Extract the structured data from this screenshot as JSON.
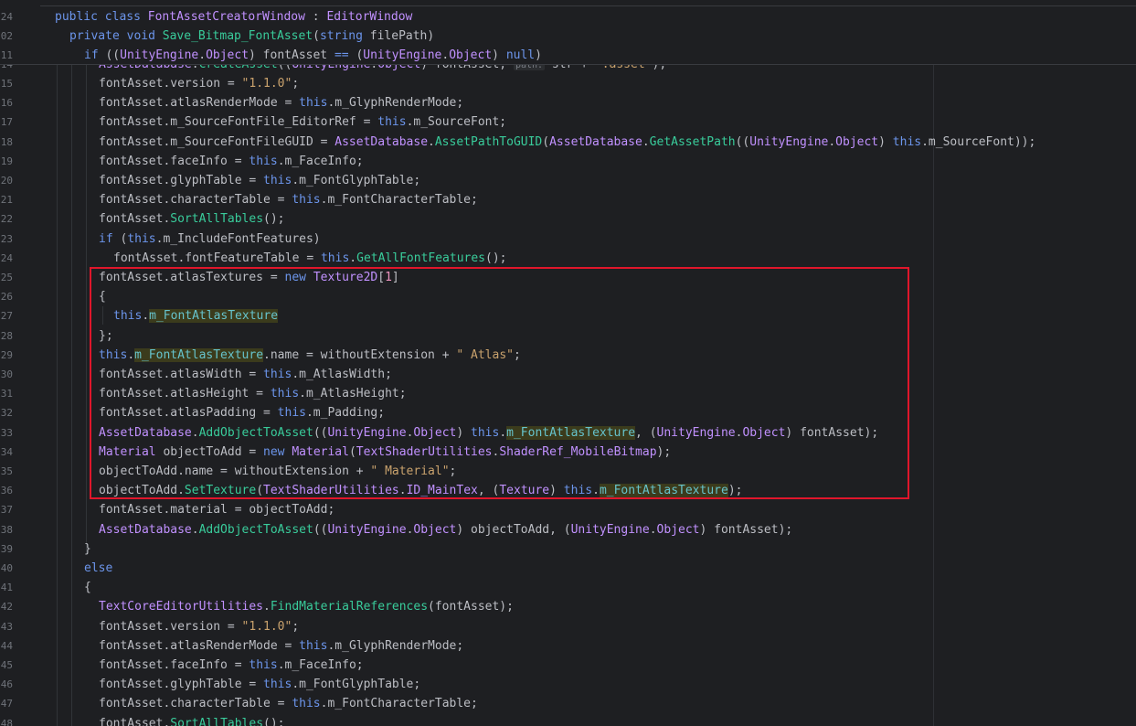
{
  "sticky_lines": [
    {
      "num": "24",
      "indent": 60,
      "tokens": [
        [
          "kw",
          "public "
        ],
        [
          "kw",
          "class "
        ],
        [
          "type",
          "FontAssetCreatorWindow"
        ],
        [
          "plain",
          " : "
        ],
        [
          "type",
          "EditorWindow"
        ]
      ]
    },
    {
      "num": "02",
      "indent": 76,
      "tokens": [
        [
          "kw",
          "private "
        ],
        [
          "kw",
          "void "
        ],
        [
          "method",
          "Save_Bitmap_FontAsset"
        ],
        [
          "plain",
          "("
        ],
        [
          "kw",
          "string "
        ],
        [
          "plain",
          "filePath)"
        ]
      ]
    },
    {
      "num": "11",
      "indent": 92,
      "tokens": [
        [
          "kw",
          "if "
        ],
        [
          "plain",
          "(("
        ],
        [
          "type",
          "UnityEngine"
        ],
        [
          "plain",
          "."
        ],
        [
          "type",
          "Object"
        ],
        [
          "plain",
          ") fontAsset "
        ],
        [
          "kw",
          "== "
        ],
        [
          "plain",
          "("
        ],
        [
          "type",
          "UnityEngine"
        ],
        [
          "plain",
          "."
        ],
        [
          "type",
          "Object"
        ],
        [
          "plain",
          ") "
        ],
        [
          "kw",
          "null"
        ],
        [
          "plain",
          ")"
        ]
      ]
    }
  ],
  "partial_line": {
    "num": "14",
    "tokens": [
      [
        "type",
        "AssetDatabase"
      ],
      [
        "plain",
        "."
      ],
      [
        "method",
        "CreateAsset"
      ],
      [
        "plain",
        "(("
      ],
      [
        "type",
        "UnityEngine"
      ],
      [
        "plain",
        "."
      ],
      [
        "type",
        "Object"
      ],
      [
        "plain",
        ") fontAsset, "
      ],
      [
        "hint",
        "path:"
      ],
      [
        "plain",
        " str + "
      ],
      [
        "str",
        "\".asset\""
      ],
      [
        "plain",
        ");"
      ]
    ]
  },
  "lines": [
    {
      "num": "15",
      "indent": 108,
      "tokens": [
        [
          "plain",
          "fontAsset.version = "
        ],
        [
          "str",
          "\"1.1.0\""
        ],
        [
          "plain",
          ";"
        ]
      ]
    },
    {
      "num": "16",
      "indent": 108,
      "tokens": [
        [
          "plain",
          "fontAsset.atlasRenderMode = "
        ],
        [
          "kw",
          "this"
        ],
        [
          "plain",
          ".m_GlyphRenderMode;"
        ]
      ]
    },
    {
      "num": "17",
      "indent": 108,
      "tokens": [
        [
          "plain",
          "fontAsset.m_SourceFontFile_EditorRef = "
        ],
        [
          "kw",
          "this"
        ],
        [
          "plain",
          ".m_SourceFont;"
        ]
      ]
    },
    {
      "num": "18",
      "indent": 108,
      "tokens": [
        [
          "plain",
          "fontAsset.m_SourceFontFileGUID = "
        ],
        [
          "type",
          "AssetDatabase"
        ],
        [
          "plain",
          "."
        ],
        [
          "method",
          "AssetPathToGUID"
        ],
        [
          "plain",
          "("
        ],
        [
          "type",
          "AssetDatabase"
        ],
        [
          "plain",
          "."
        ],
        [
          "method",
          "GetAssetPath"
        ],
        [
          "plain",
          "(("
        ],
        [
          "type",
          "UnityEngine"
        ],
        [
          "plain",
          "."
        ],
        [
          "type",
          "Object"
        ],
        [
          "plain",
          ") "
        ],
        [
          "kw",
          "this"
        ],
        [
          "plain",
          ".m_SourceFont));"
        ]
      ]
    },
    {
      "num": "19",
      "indent": 108,
      "tokens": [
        [
          "plain",
          "fontAsset.faceInfo = "
        ],
        [
          "kw",
          "this"
        ],
        [
          "plain",
          ".m_FaceInfo;"
        ]
      ]
    },
    {
      "num": "20",
      "indent": 108,
      "tokens": [
        [
          "plain",
          "fontAsset.glyphTable = "
        ],
        [
          "kw",
          "this"
        ],
        [
          "plain",
          ".m_FontGlyphTable;"
        ]
      ]
    },
    {
      "num": "21",
      "indent": 108,
      "tokens": [
        [
          "plain",
          "fontAsset.characterTable = "
        ],
        [
          "kw",
          "this"
        ],
        [
          "plain",
          ".m_FontCharacterTable;"
        ]
      ]
    },
    {
      "num": "22",
      "indent": 108,
      "tokens": [
        [
          "plain",
          "fontAsset."
        ],
        [
          "method",
          "SortAllTables"
        ],
        [
          "plain",
          "();"
        ]
      ]
    },
    {
      "num": "23",
      "indent": 108,
      "tokens": [
        [
          "kw",
          "if "
        ],
        [
          "plain",
          "("
        ],
        [
          "kw",
          "this"
        ],
        [
          "plain",
          ".m_IncludeFontFeatures)"
        ]
      ]
    },
    {
      "num": "24",
      "indent": 124,
      "tokens": [
        [
          "plain",
          "fontAsset.fontFeatureTable = "
        ],
        [
          "kw",
          "this"
        ],
        [
          "plain",
          "."
        ],
        [
          "method",
          "GetAllFontFeatures"
        ],
        [
          "plain",
          "();"
        ]
      ]
    },
    {
      "num": "25",
      "indent": 108,
      "tokens": [
        [
          "plain",
          "fontAsset.atlasTextures = "
        ],
        [
          "kw",
          "new "
        ],
        [
          "type",
          "Texture2D"
        ],
        [
          "plain",
          "["
        ],
        [
          "num",
          "1"
        ],
        [
          "plain",
          "]"
        ]
      ]
    },
    {
      "num": "26",
      "indent": 108,
      "tokens": [
        [
          "plain",
          "{"
        ]
      ]
    },
    {
      "num": "27",
      "indent": 124,
      "tokens": [
        [
          "kw",
          "this"
        ],
        [
          "plain",
          "."
        ],
        [
          "hl",
          "m_FontAtlasTexture"
        ]
      ]
    },
    {
      "num": "28",
      "indent": 108,
      "tokens": [
        [
          "plain",
          "};"
        ]
      ]
    },
    {
      "num": "29",
      "indent": 108,
      "tokens": [
        [
          "kw",
          "this"
        ],
        [
          "plain",
          "."
        ],
        [
          "hl",
          "m_FontAtlasTexture"
        ],
        [
          "plain",
          ".name = withoutExtension + "
        ],
        [
          "str",
          "\" Atlas\""
        ],
        [
          "plain",
          ";"
        ]
      ]
    },
    {
      "num": "30",
      "indent": 108,
      "tokens": [
        [
          "plain",
          "fontAsset.atlasWidth = "
        ],
        [
          "kw",
          "this"
        ],
        [
          "plain",
          ".m_AtlasWidth;"
        ]
      ]
    },
    {
      "num": "31",
      "indent": 108,
      "tokens": [
        [
          "plain",
          "fontAsset.atlasHeight = "
        ],
        [
          "kw",
          "this"
        ],
        [
          "plain",
          ".m_AtlasHeight;"
        ]
      ]
    },
    {
      "num": "32",
      "indent": 108,
      "tokens": [
        [
          "plain",
          "fontAsset.atlasPadding = "
        ],
        [
          "kw",
          "this"
        ],
        [
          "plain",
          ".m_Padding;"
        ]
      ]
    },
    {
      "num": "33",
      "indent": 108,
      "tokens": [
        [
          "type",
          "AssetDatabase"
        ],
        [
          "plain",
          "."
        ],
        [
          "method",
          "AddObjectToAsset"
        ],
        [
          "plain",
          "(("
        ],
        [
          "type",
          "UnityEngine"
        ],
        [
          "plain",
          "."
        ],
        [
          "type",
          "Object"
        ],
        [
          "plain",
          ") "
        ],
        [
          "kw",
          "this"
        ],
        [
          "plain",
          "."
        ],
        [
          "hl",
          "m_FontAtlasTexture"
        ],
        [
          "plain",
          ", ("
        ],
        [
          "type",
          "UnityEngine"
        ],
        [
          "plain",
          "."
        ],
        [
          "type",
          "Object"
        ],
        [
          "plain",
          ") fontAsset);"
        ]
      ]
    },
    {
      "num": "34",
      "indent": 108,
      "tokens": [
        [
          "type",
          "Material "
        ],
        [
          "plain",
          "objectToAdd = "
        ],
        [
          "kw",
          "new "
        ],
        [
          "type",
          "Material"
        ],
        [
          "plain",
          "("
        ],
        [
          "type",
          "TextShaderUtilities"
        ],
        [
          "plain",
          "."
        ],
        [
          "type",
          "ShaderRef_MobileBitmap"
        ],
        [
          "plain",
          ");"
        ]
      ]
    },
    {
      "num": "35",
      "indent": 108,
      "tokens": [
        [
          "plain",
          "objectToAdd.name = withoutExtension + "
        ],
        [
          "str",
          "\" Material\""
        ],
        [
          "plain",
          ";"
        ]
      ]
    },
    {
      "num": "36",
      "indent": 108,
      "tokens": [
        [
          "plain",
          "objectToAdd."
        ],
        [
          "method",
          "SetTexture"
        ],
        [
          "plain",
          "("
        ],
        [
          "type",
          "TextShaderUtilities"
        ],
        [
          "plain",
          "."
        ],
        [
          "type",
          "ID_MainTex"
        ],
        [
          "plain",
          ", ("
        ],
        [
          "type",
          "Texture"
        ],
        [
          "plain",
          ") "
        ],
        [
          "kw",
          "this"
        ],
        [
          "plain",
          "."
        ],
        [
          "hl",
          "m_FontAtlasTexture"
        ],
        [
          "plain",
          ");"
        ]
      ]
    },
    {
      "num": "37",
      "indent": 108,
      "tokens": [
        [
          "plain",
          "fontAsset.material = objectToAdd;"
        ]
      ]
    },
    {
      "num": "38",
      "indent": 108,
      "tokens": [
        [
          "type",
          "AssetDatabase"
        ],
        [
          "plain",
          "."
        ],
        [
          "method",
          "AddObjectToAsset"
        ],
        [
          "plain",
          "(("
        ],
        [
          "type",
          "UnityEngine"
        ],
        [
          "plain",
          "."
        ],
        [
          "type",
          "Object"
        ],
        [
          "plain",
          ") objectToAdd, ("
        ],
        [
          "type",
          "UnityEngine"
        ],
        [
          "plain",
          "."
        ],
        [
          "type",
          "Object"
        ],
        [
          "plain",
          ") fontAsset);"
        ]
      ]
    },
    {
      "num": "39",
      "indent": 92,
      "tokens": [
        [
          "plain",
          "}"
        ]
      ]
    },
    {
      "num": "40",
      "indent": 92,
      "tokens": [
        [
          "kw",
          "else"
        ]
      ]
    },
    {
      "num": "41",
      "indent": 92,
      "tokens": [
        [
          "plain",
          "{"
        ]
      ]
    },
    {
      "num": "42",
      "indent": 108,
      "tokens": [
        [
          "type",
          "TextCoreEditorUtilities"
        ],
        [
          "plain",
          "."
        ],
        [
          "method",
          "FindMaterialReferences"
        ],
        [
          "plain",
          "(fontAsset);"
        ]
      ]
    },
    {
      "num": "43",
      "indent": 108,
      "tokens": [
        [
          "plain",
          "fontAsset.version = "
        ],
        [
          "str",
          "\"1.1.0\""
        ],
        [
          "plain",
          ";"
        ]
      ]
    },
    {
      "num": "44",
      "indent": 108,
      "tokens": [
        [
          "plain",
          "fontAsset.atlasRenderMode = "
        ],
        [
          "kw",
          "this"
        ],
        [
          "plain",
          ".m_GlyphRenderMode;"
        ]
      ]
    },
    {
      "num": "45",
      "indent": 108,
      "tokens": [
        [
          "plain",
          "fontAsset.faceInfo = "
        ],
        [
          "kw",
          "this"
        ],
        [
          "plain",
          ".m_FaceInfo;"
        ]
      ]
    },
    {
      "num": "46",
      "indent": 108,
      "tokens": [
        [
          "plain",
          "fontAsset.glyphTable = "
        ],
        [
          "kw",
          "this"
        ],
        [
          "plain",
          ".m_FontGlyphTable;"
        ]
      ]
    },
    {
      "num": "47",
      "indent": 108,
      "tokens": [
        [
          "plain",
          "fontAsset.characterTable = "
        ],
        [
          "kw",
          "this"
        ],
        [
          "plain",
          ".m_FontCharacterTable;"
        ]
      ]
    },
    {
      "num": "48",
      "indent": 108,
      "tokens": [
        [
          "plain",
          "fontAsset."
        ],
        [
          "method",
          "SortAllTables"
        ],
        [
          "plain",
          "();"
        ]
      ]
    }
  ]
}
